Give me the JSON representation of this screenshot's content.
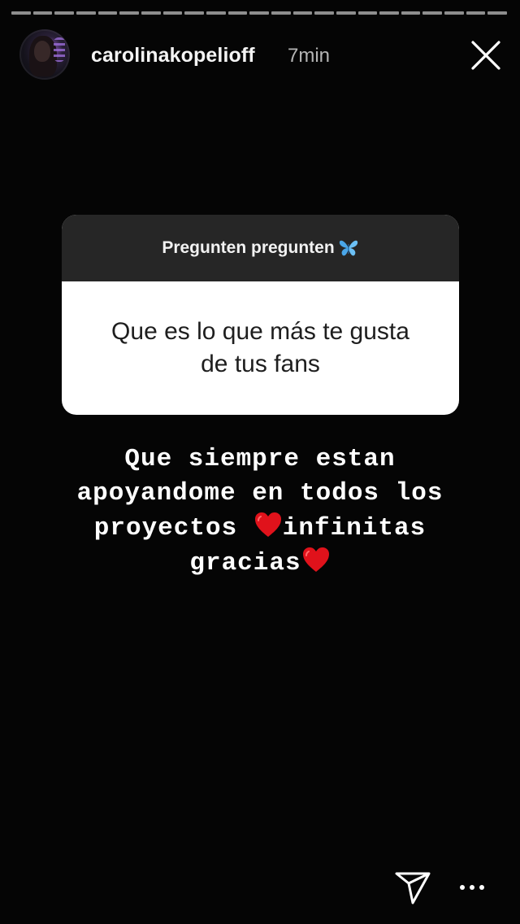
{
  "story": {
    "progress_segments": 23,
    "username": "carolinakopelioff",
    "time": "7min"
  },
  "question_sticker": {
    "title": "Pregunten pregunten",
    "title_emoji": "butterfly-icon",
    "question_line1": "Que es lo que más te gusta",
    "question_line2": "de tus fans"
  },
  "answer": {
    "line1": "Que siempre estan",
    "line2": "apoyandome en todos los",
    "line3_a": "proyectos ",
    "line3_b": "infinitas",
    "line4": "gracias"
  },
  "icons": {
    "close": "close-icon",
    "send": "send-icon",
    "more": "more-options-icon",
    "heart_color": "#e0121b",
    "butterfly_color": "#4aa6e8"
  }
}
